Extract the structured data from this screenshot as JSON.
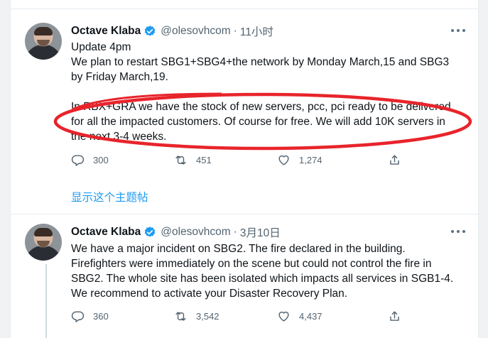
{
  "tweets": [
    {
      "name": "Octave Klaba",
      "handle": "@olesovhcom",
      "separator": "·",
      "time": "11小时",
      "lines": [
        "Update 4pm",
        "We plan to restart SBG1+SBG4+the network by Monday March,15 and SBG3",
        "by Friday March,19.",
        "In RBX+GRA we have the stock of new servers, pcc, pci ready to be delivered",
        "for all the impacted customers. Of course for free. We will add 10K servers in",
        "the next 3-4 weeks."
      ],
      "reply_count": "300",
      "retweet_count": "451",
      "like_count": "1,274"
    },
    {
      "name": "Octave Klaba",
      "handle": "@olesovhcom",
      "separator": "·",
      "time": "3月10日",
      "lines": [
        "We have a major incident on SBG2. The fire declared in the building.",
        "Firefighters were immediately on the scene but could not control the fire in",
        "SBG2. The whole site has been isolated which impacts all services in SGB1-4.",
        "We recommend to activate your Disaster Recovery Plan."
      ],
      "reply_count": "360",
      "retweet_count": "3,542",
      "like_count": "4,437"
    }
  ],
  "show_thread": "显示这个主题帖",
  "colors": {
    "accent": "#1d9bf0",
    "annotation": "#e8242b",
    "muted": "#536471"
  }
}
